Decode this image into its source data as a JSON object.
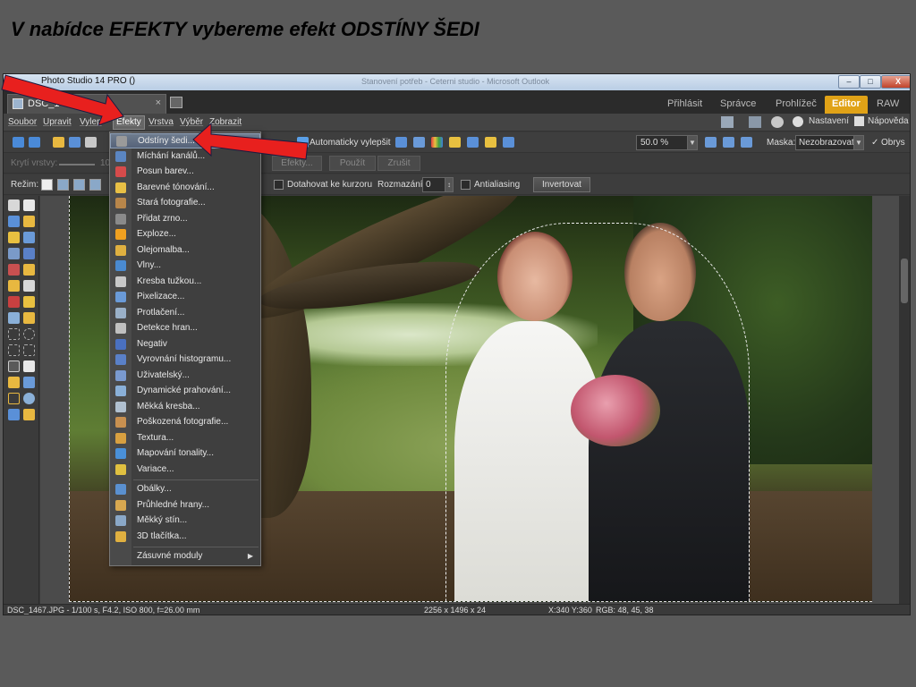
{
  "slide": {
    "title": "V nabídce EFEKTY vybereme efekt ODSTÍNY ŠEDI"
  },
  "window": {
    "title": "Photo Studio 14 PRO  ()",
    "background_title": "Stanovení potřeb - Ceterni studio - Microsoft Outlook",
    "controls": {
      "minimize": "–",
      "maximize": "□",
      "close": "X"
    }
  },
  "tabs": {
    "document": {
      "label": "DSC_1",
      "close": "×"
    },
    "modes": [
      {
        "label": "Přihlásit",
        "active": false
      },
      {
        "label": "Správce",
        "active": false
      },
      {
        "label": "Prohlížeč",
        "active": false
      },
      {
        "label": "Editor",
        "active": true
      },
      {
        "label": "RAW",
        "active": false
      }
    ]
  },
  "menubar": {
    "items": [
      "Soubor",
      "Upravit",
      "Vylep",
      "Efekty",
      "Vrstva",
      "Výběr",
      "Zobrazit"
    ],
    "active": "Efekty",
    "settings": "Nastavení",
    "help": "Nápověda"
  },
  "toolbar": {
    "auto_enhance": "Automaticky vylepšit",
    "zoom": "50.0 %",
    "mask_label": "Maska:",
    "mask_value": "Nezobrazovat",
    "outline_label": "Obrys",
    "outline_checked": true
  },
  "toolbar2": {
    "opacity_label": "Krytí vrstvy:",
    "opacity_value": "100",
    "buttons": [
      "Efekty...",
      "Použít",
      "Zrušit"
    ]
  },
  "toolbar3": {
    "mode_label": "Režim:",
    "snap_label": "Dotahovat ke kurzoru",
    "blur_label": "Rozmazání:",
    "blur_value": "0",
    "antialias_label": "Antialiasing",
    "invert_button": "Invertovat"
  },
  "effects_menu": {
    "items": [
      {
        "label": "Odstíny šedi...",
        "icon": "grayscale-icon",
        "color": "#9a9a9a",
        "selected": true
      },
      {
        "label": "Míchání kanálů...",
        "icon": "channel-mixer-icon",
        "color": "#5b86c2"
      },
      {
        "label": "Posun barev...",
        "icon": "color-shift-icon",
        "color": "#d64b4b"
      },
      {
        "label": "Barevné tónování...",
        "icon": "color-toning-icon",
        "color": "#e8c045"
      },
      {
        "label": "Stará fotografie...",
        "icon": "old-photo-icon",
        "color": "#b8864a"
      },
      {
        "label": "Přidat zrno...",
        "icon": "grain-icon",
        "color": "#8a8a8a"
      },
      {
        "label": "Exploze...",
        "icon": "explosion-icon",
        "color": "#f0a020"
      },
      {
        "label": "Olejomalba...",
        "icon": "oil-paint-icon",
        "color": "#e0b040"
      },
      {
        "label": "Vlny...",
        "icon": "waves-icon",
        "color": "#4a8ad0"
      },
      {
        "label": "Kresba tužkou...",
        "icon": "pencil-drawing-icon",
        "color": "#c8c8c8"
      },
      {
        "label": "Pixelizace...",
        "icon": "pixelate-icon",
        "color": "#6a9ad8"
      },
      {
        "label": "Protlačení...",
        "icon": "emboss-icon",
        "color": "#9ab0c8"
      },
      {
        "label": "Detekce hran...",
        "icon": "edge-detect-icon",
        "color": "#c0c0c0"
      },
      {
        "label": "Negativ",
        "icon": "negative-icon",
        "color": "#4a70c0"
      },
      {
        "label": "Vyrovnání histogramu...",
        "icon": "histogram-icon",
        "color": "#5a80c8"
      },
      {
        "label": "Uživatelský...",
        "icon": "custom-filter-icon",
        "color": "#7a9ad0"
      },
      {
        "label": "Dynamické prahování...",
        "icon": "threshold-icon",
        "color": "#8ab0d8"
      },
      {
        "label": "Měkká kresba...",
        "icon": "soft-drawing-icon",
        "color": "#b0c0d0"
      },
      {
        "label": "Poškozená fotografie...",
        "icon": "damaged-photo-icon",
        "color": "#c89050"
      },
      {
        "label": "Textura...",
        "icon": "texture-icon",
        "color": "#d8a040"
      },
      {
        "label": "Mapování tonality...",
        "icon": "tone-mapping-icon",
        "color": "#4a90d8"
      },
      {
        "label": "Variace...",
        "icon": "variations-icon",
        "color": "#e0c040"
      },
      {
        "label": "Obálky...",
        "icon": "envelopes-icon",
        "color": "#5a90d0"
      },
      {
        "label": "Průhledné hrany...",
        "icon": "transparent-edges-icon",
        "color": "#d8a850"
      },
      {
        "label": "Měkký stín...",
        "icon": "soft-shadow-icon",
        "color": "#8aa8c8"
      },
      {
        "label": "3D tlačítka...",
        "icon": "3d-buttons-icon",
        "color": "#e0b040"
      },
      {
        "label": "Zásuvné moduly",
        "icon": "",
        "color": "",
        "submenu": true
      }
    ],
    "submenu_arrow": "▶"
  },
  "status": {
    "file_info": "DSC_1467.JPG - 1/100 s, F4.2, ISO 800, f=26.00 mm",
    "dimensions": "2256 x 1496 x 24",
    "coords": "X:340 Y:360",
    "rgb": "RGB: 48, 45, 38"
  },
  "colors": {
    "accent": "#e0a217",
    "arrow": "#e8201e",
    "selection": "#6e7c8e"
  }
}
